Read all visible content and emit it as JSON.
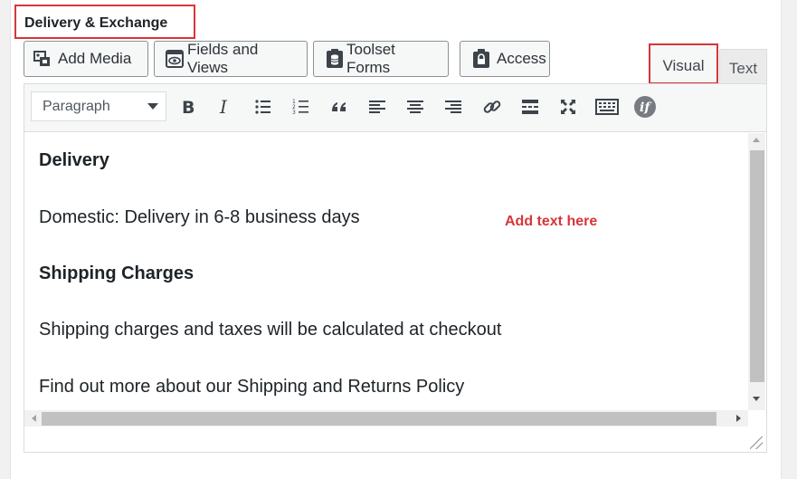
{
  "metabox": {
    "title": "Delivery & Exchange"
  },
  "media_buttons": [
    {
      "label": "Add Media",
      "icon": "add-media-icon"
    },
    {
      "label": "Fields and Views",
      "icon": "eye-icon"
    },
    {
      "label": "Toolset Forms",
      "icon": "database-icon"
    },
    {
      "label": "Access",
      "icon": "lock-icon"
    }
  ],
  "tabs": {
    "visual": "Visual",
    "text": "Text",
    "active": "visual"
  },
  "toolbar": {
    "format": "Paragraph",
    "buttons": [
      "bold-icon",
      "italic-icon",
      "bullet-list-icon",
      "numbered-list-icon",
      "blockquote-icon",
      "align-left-icon",
      "align-center-icon",
      "align-right-icon",
      "link-icon",
      "read-more-icon",
      "fullscreen-icon",
      "toolbar-toggle-icon",
      "conditional-if-icon"
    ]
  },
  "content": {
    "heading1": "Delivery",
    "line1": "Domestic: Delivery in 6-8 business days",
    "heading2": "Shipping Charges",
    "line2": "Shipping charges and taxes will be calculated at checkout",
    "line3": "Find out more about our Shipping and Returns Policy"
  },
  "annotation": "Add text here",
  "colors": {
    "highlight": "#d63638",
    "text": "#1d2327",
    "toolbar": "#f6f7f7"
  }
}
